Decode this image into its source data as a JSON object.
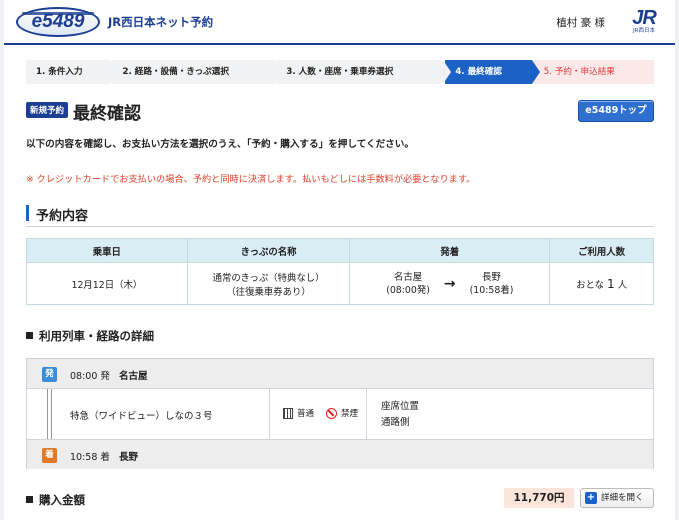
{
  "header": {
    "logo_text": "e5489",
    "brand": "JR西日本ネット予約",
    "user_name": "植村 豪 様",
    "jr_logo": "JR",
    "jr_logo_sub": "JR西日本"
  },
  "steps": [
    {
      "label": "1. 条件入力"
    },
    {
      "label": "2. 経路・設備・きっぷ選択"
    },
    {
      "label": "3. 人数・座席・乗車券選択"
    },
    {
      "label": "4. 最終確認",
      "active": true
    },
    {
      "label": "5. 予約・申込結果"
    }
  ],
  "page": {
    "badge": "新規予約",
    "title": "最終確認",
    "top_button": "e5489トップ",
    "intro": "以下の内容を確認し、お支払い方法を選択のうえ、「予約・購入する」を押してください。",
    "warning": "※ クレジットカードでお支払いの場合、予約と同時に決済します。払いもどしには手数料が必要となります。"
  },
  "reservation": {
    "section_title": "予約内容",
    "headers": [
      "乗車日",
      "きっぷの名称",
      "発着",
      "ご利用人数"
    ],
    "date": "12月12日（木）",
    "ticket_line1": "通常のきっぷ（特典なし）",
    "ticket_line2": "（往復乗車券あり）",
    "from_station": "名古屋",
    "from_time": "(08:00発)",
    "arrow": "→",
    "to_station": "長野",
    "to_time": "(10:58着)",
    "pax_prefix": "おとな",
    "pax_count": "1",
    "pax_suffix": "人"
  },
  "train_detail": {
    "section_title": "利用列車・経路の詳細",
    "dep_mark": "発",
    "dep_time": "08:00 発",
    "dep_station": "名古屋",
    "train_name": "特急（ワイドビュー）しなの３号",
    "car_type": "普通",
    "smoking": "禁煙",
    "seat_label": "座席位置",
    "seat_value": "通路側",
    "arr_mark": "着",
    "arr_time": "10:58 着",
    "arr_station": "長野"
  },
  "price": {
    "section_title": "購入金額",
    "amount": "11,770円",
    "detail_button": "詳細を開く",
    "plus_icon": "+"
  }
}
